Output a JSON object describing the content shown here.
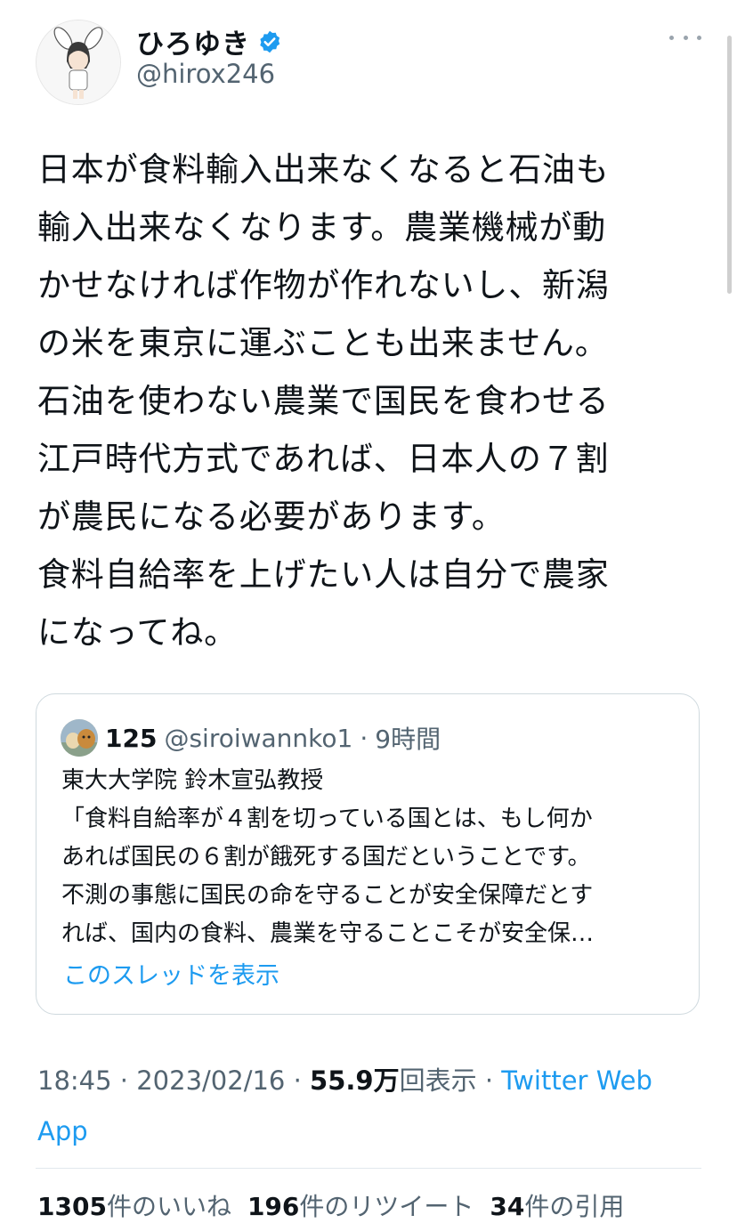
{
  "author": {
    "display_name": "ひろゆき",
    "handle": "@hirox246",
    "verified_icon": "verified-badge-icon",
    "accent": "#1d9bf0"
  },
  "tweet": {
    "text": "日本が食料輸入出来なくなると石油も\n輸入出来なくなります。農業機械が動\nかせなければ作物が作れないし、新潟\nの米を東京に運ぶことも出来ません。\n石油を使わない農業で国民を食わせる\n江戸時代方式であれば、日本人の７割\nが農民になる必要があります。\n食料自給率を上げたい人は自分で農家\nになってね。"
  },
  "quote": {
    "name": "125",
    "handle": "@siroiwannko1",
    "separator": "·",
    "time": "9時間",
    "text": "東大大学院 鈴木宣弘教授\n「食料自給率が４割を切っている国とは、もし何か\nあれば国民の６割が餓死する国だということです。\n不測の事態に国民の命を守ることが安全保障だとす\nれば、国内の食料、農業を守ることこそが安全保…",
    "show_thread": "このスレッドを表示"
  },
  "meta": {
    "time": "18:45",
    "dot1": "·",
    "date": "2023/02/16",
    "dot2": "·",
    "views": "55.9万",
    "views_label": "回表示",
    "dot3": "·",
    "source": "Twitter Web App"
  },
  "stats": {
    "likes_count": "1305",
    "likes_label": "件のいいね",
    "retweets_count": "196",
    "retweets_label": "件のリツイート",
    "quotes_count": "34",
    "quotes_label": "件の引用"
  }
}
